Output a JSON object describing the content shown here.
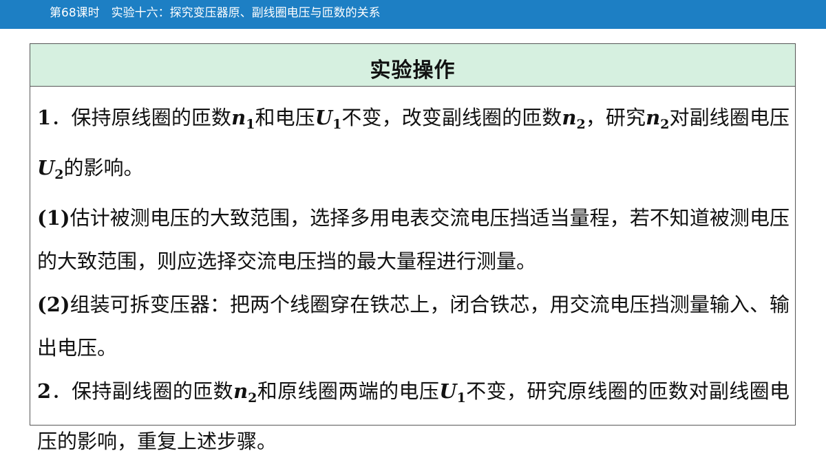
{
  "header": {
    "title": "第68课时　实验十六：探究变压器原、副线圈电压与匝数的关系"
  },
  "panel": {
    "heading": "实验操作"
  },
  "content": {
    "p1": {
      "num": "1",
      "t1": "．保持原线圈的匝数",
      "v1": "n",
      "s1": "1",
      "t2": "和电压",
      "v2": "U",
      "s2": "1",
      "t3": "不变，改变副线圈的匝数",
      "v3": "n",
      "s3": "2",
      "t4": "，研究",
      "v4": "n",
      "s4": "2",
      "t5": "对副线圈电压",
      "v5": "U",
      "s5": "2",
      "t6": "的影响。"
    },
    "p2": {
      "label": "(1)",
      "text": "估计被测电压的大致范围，选择多用电表交流电压挡适当量程，若不知道被测电压的大致范围，则应选择交流电压挡的最大量程进行测量。"
    },
    "p3": {
      "label": "(2)",
      "text": "组装可拆变压器：把两个线圈穿在铁芯上，闭合铁芯，用交流电压挡测量输入、输出电压。"
    },
    "p4": {
      "num": "2",
      "t1": "．保持副线圈的匝数",
      "v1": "n",
      "s1": "2",
      "t2": "和原线圈两端的电压",
      "v2": "U",
      "s2": "1",
      "t3": "不变，研究原线圈的匝数对副线圈电压的影响，重复上述步骤。"
    }
  }
}
